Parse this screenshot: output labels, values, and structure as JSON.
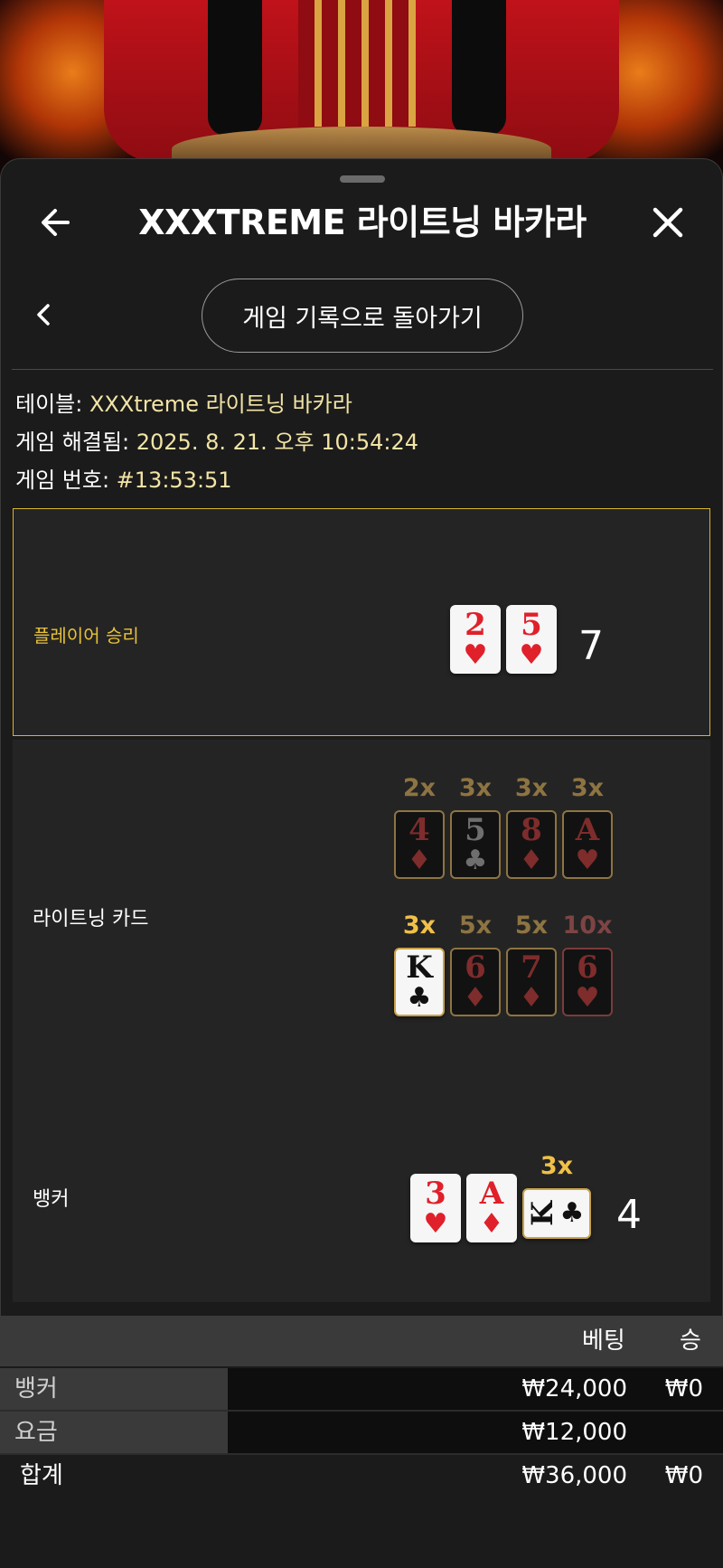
{
  "header": {
    "title": "XXXTREME 라이트닝 바카라",
    "back_icon": "arrow-left-icon",
    "close_icon": "close-icon"
  },
  "subnav": {
    "back_icon": "chevron-left-icon",
    "history_button": "게임 기록으로 돌아가기"
  },
  "info": {
    "table_label": "테이블: ",
    "table_value": "XXXtreme 라이트닝 바카라",
    "resolved_label": "게임 해결됨: ",
    "resolved_value": "2025. 8. 21. 오후 10:54:24",
    "number_label": "게임 번호: ",
    "number_value": "#13:53:51"
  },
  "player": {
    "label": "플레이어 승리",
    "cards": [
      {
        "rank": "2",
        "suit": "♥",
        "color": "red"
      },
      {
        "rank": "5",
        "suit": "♥",
        "color": "red"
      }
    ],
    "score": "7"
  },
  "lightning": {
    "label": "라이트닝 카드",
    "row1": [
      {
        "mult": "2x",
        "rank": "4",
        "suit": "♦",
        "color": "red"
      },
      {
        "mult": "3x",
        "rank": "5",
        "suit": "♣",
        "color": "black"
      },
      {
        "mult": "3x",
        "rank": "8",
        "suit": "♦",
        "color": "red"
      },
      {
        "mult": "3x",
        "rank": "A",
        "suit": "♥",
        "color": "red"
      }
    ],
    "row2": [
      {
        "mult": "3x",
        "rank": "K",
        "suit": "♣",
        "color": "black",
        "active": true
      },
      {
        "mult": "5x",
        "rank": "6",
        "suit": "♦",
        "color": "red"
      },
      {
        "mult": "5x",
        "rank": "7",
        "suit": "♦",
        "color": "red"
      },
      {
        "mult": "10x",
        "rank": "6",
        "suit": "♥",
        "color": "red"
      }
    ]
  },
  "banker": {
    "label": "뱅커",
    "cards": [
      {
        "rank": "3",
        "suit": "♥",
        "color": "red"
      },
      {
        "rank": "A",
        "suit": "♦",
        "color": "red"
      },
      {
        "rank": "K",
        "suit": "♣",
        "color": "black",
        "mult": "3x"
      }
    ],
    "score": "4"
  },
  "bets": {
    "col_bet": "베팅",
    "col_win": "승",
    "rows": [
      {
        "name": "뱅커",
        "bet": "₩24,000",
        "win": "₩0"
      },
      {
        "name": "요금",
        "bet": "₩12,000",
        "win": ""
      }
    ],
    "total": {
      "name": "합계",
      "bet": "₩36,000",
      "win": "₩0"
    }
  },
  "colors": {
    "accent_gold": "#e8c13a",
    "info_value": "#f3e4a6",
    "card_red": "#e0202a"
  }
}
